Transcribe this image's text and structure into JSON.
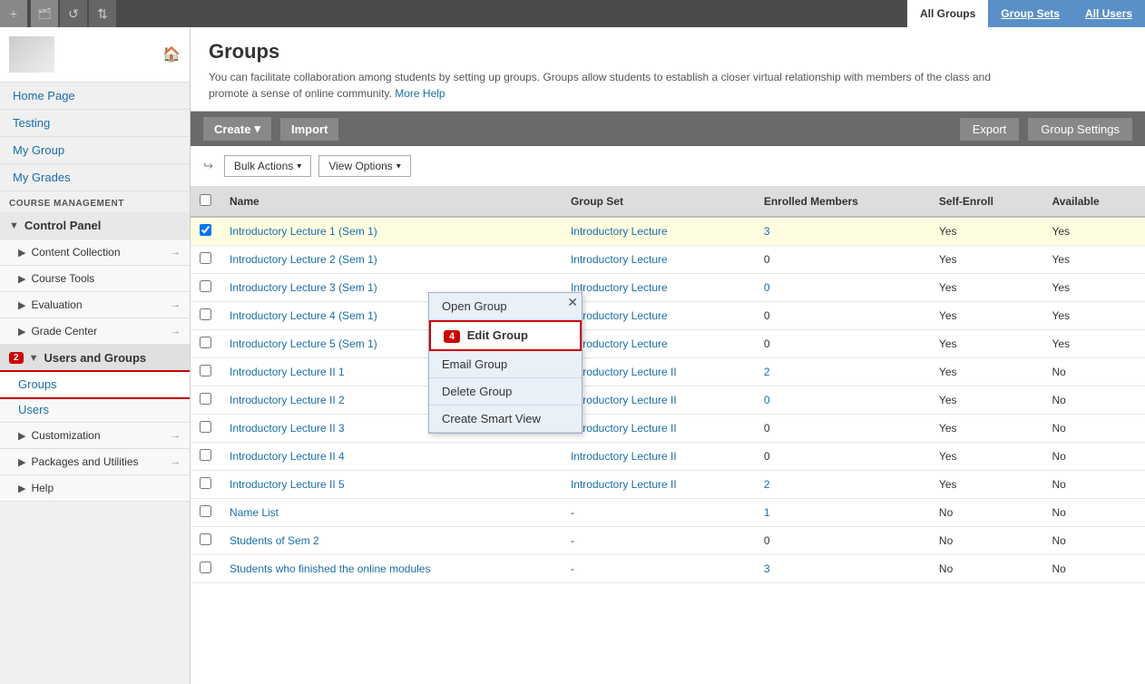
{
  "topbar": {
    "icons": [
      "+",
      "📁",
      "↺",
      "↕"
    ]
  },
  "group_tabs": {
    "all_groups": "All Groups",
    "group_sets": "Group Sets",
    "all_users": "All Users"
  },
  "sidebar": {
    "nav_items": [
      "Home Page",
      "Testing",
      "My Group",
      "My Grades"
    ],
    "course_management_label": "COURSE MANAGEMENT",
    "control_panel": "Control Panel",
    "content_collection": "Content Collection",
    "course_tools": "Course Tools",
    "evaluation": "Evaluation",
    "grade_center": "Grade Center",
    "users_and_groups": "Users and Groups",
    "groups": "Groups",
    "users": "Users",
    "customization": "Customization",
    "packages_and_utilities": "Packages and Utilities",
    "help": "Help"
  },
  "page_header": {
    "title": "Groups",
    "description": "You can facilitate collaboration among students by setting up groups. Groups allow students to establish a closer virtual relationship with members of the class and promote a sense of online community.",
    "more_help": "More Help"
  },
  "action_bar": {
    "create_label": "Create",
    "import_label": "Import",
    "export_label": "Export",
    "group_settings_label": "Group Settings"
  },
  "filter_bar": {
    "bulk_actions": "Bulk Actions",
    "view_options": "View Options"
  },
  "table": {
    "headers": [
      "",
      "Name",
      "Group Set",
      "Enrolled Members",
      "Self-Enroll",
      "Available"
    ],
    "rows": [
      {
        "name": "Introductory Lecture 1 (Sem 1)",
        "group_set": "Introductory Lecture",
        "enrolled": "3",
        "self_enroll": "Yes",
        "available": "Yes",
        "highlighted": true,
        "enrolled_link": false
      },
      {
        "name": "Introductory Lecture 2 (Sem 1)",
        "group_set": "Introductory Lecture",
        "enrolled": "0",
        "self_enroll": "Yes",
        "available": "Yes",
        "highlighted": false,
        "enrolled_link": false
      },
      {
        "name": "Introductory Lecture 3 (Sem 1)",
        "group_set": "Introductory Lecture",
        "enrolled": "0",
        "self_enroll": "Yes",
        "available": "Yes",
        "highlighted": false,
        "enrolled_link": true
      },
      {
        "name": "Introductory Lecture 4 (Sem 1)",
        "group_set": "Introductory Lecture",
        "enrolled": "0",
        "self_enroll": "Yes",
        "available": "Yes",
        "highlighted": false,
        "enrolled_link": false
      },
      {
        "name": "Introductory Lecture 5 (Sem 1)",
        "group_set": "Introductory Lecture",
        "enrolled": "0",
        "self_enroll": "Yes",
        "available": "Yes",
        "highlighted": false,
        "enrolled_link": false
      },
      {
        "name": "Introductory Lecture II 1",
        "group_set": "Introductory Lecture II",
        "enrolled": "2",
        "self_enroll": "Yes",
        "available": "No",
        "highlighted": false,
        "enrolled_link": false
      },
      {
        "name": "Introductory Lecture II 2",
        "group_set": "Introductory Lecture II",
        "enrolled": "0",
        "self_enroll": "Yes",
        "available": "No",
        "highlighted": false,
        "enrolled_link": true
      },
      {
        "name": "Introductory Lecture II 3",
        "group_set": "Introductory Lecture II",
        "enrolled": "0",
        "self_enroll": "Yes",
        "available": "No",
        "highlighted": false,
        "enrolled_link": false
      },
      {
        "name": "Introductory Lecture II 4",
        "group_set": "Introductory Lecture II",
        "enrolled": "0",
        "self_enroll": "Yes",
        "available": "No",
        "highlighted": false,
        "enrolled_link": false
      },
      {
        "name": "Introductory Lecture II 5",
        "group_set": "Introductory Lecture II",
        "enrolled": "2",
        "self_enroll": "Yes",
        "available": "No",
        "highlighted": false,
        "enrolled_link": false
      },
      {
        "name": "Name List",
        "group_set": "-",
        "enrolled": "1",
        "self_enroll": "No",
        "available": "No",
        "highlighted": false,
        "enrolled_link": true
      },
      {
        "name": "Students of Sem 2",
        "group_set": "-",
        "enrolled": "0",
        "self_enroll": "No",
        "available": "No",
        "highlighted": false,
        "enrolled_link": false
      },
      {
        "name": "Students who finished the online modules",
        "group_set": "-",
        "enrolled": "3",
        "self_enroll": "No",
        "available": "No",
        "highlighted": false,
        "enrolled_link": false
      }
    ]
  },
  "context_menu": {
    "items": [
      "Open Group",
      "Edit Group",
      "Email Group",
      "Delete Group",
      "Create Smart View"
    ],
    "active_item": "Edit Group"
  },
  "badges": {
    "step2": "2",
    "step4": "4"
  }
}
